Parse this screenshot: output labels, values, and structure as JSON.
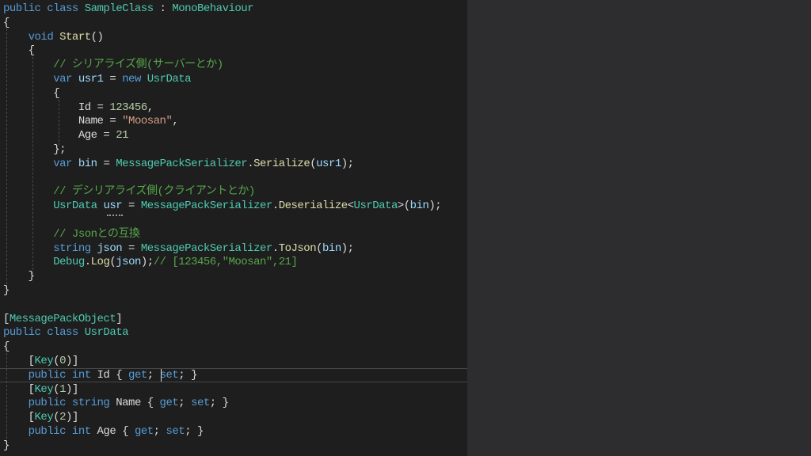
{
  "editor": {
    "background": "#1e1e1e",
    "side_panel_background": "#2d2d30",
    "colors": {
      "keyword": "#569cd6",
      "type": "#4ec9b0",
      "text": "#dcdcdc",
      "method": "#dcdcaa",
      "number": "#b5cea8",
      "string": "#d69d85",
      "comment": "#57a64a",
      "variable": "#9cdcfe"
    },
    "lines": [
      [
        [
          "kw",
          "public class "
        ],
        [
          "ty",
          "SampleClass"
        ],
        [
          "tx",
          " : "
        ],
        [
          "ty",
          "MonoBehaviour"
        ]
      ],
      [
        [
          "tx",
          "{"
        ]
      ],
      [
        [
          "tx",
          "    "
        ],
        [
          "kw",
          "void "
        ],
        [
          "fn",
          "Start"
        ],
        [
          "tx",
          "()"
        ]
      ],
      [
        [
          "tx",
          "    {"
        ]
      ],
      [
        [
          "tx",
          "        "
        ],
        [
          "cm",
          "// シリアライズ側(サーバーとか)"
        ]
      ],
      [
        [
          "tx",
          "        "
        ],
        [
          "kw",
          "var "
        ],
        [
          "va",
          "usr1"
        ],
        [
          "tx",
          " = "
        ],
        [
          "kw",
          "new "
        ],
        [
          "ty",
          "UsrData"
        ]
      ],
      [
        [
          "tx",
          "        {"
        ]
      ],
      [
        [
          "tx",
          "            Id = "
        ],
        [
          "nu",
          "123456"
        ],
        [
          "tx",
          ","
        ]
      ],
      [
        [
          "tx",
          "            Name = "
        ],
        [
          "st",
          "\"Moosan\""
        ],
        [
          "tx",
          ","
        ]
      ],
      [
        [
          "tx",
          "            Age = "
        ],
        [
          "nu",
          "21"
        ]
      ],
      [
        [
          "tx",
          "        };"
        ]
      ],
      [
        [
          "tx",
          "        "
        ],
        [
          "kw",
          "var "
        ],
        [
          "va",
          "bin"
        ],
        [
          "tx",
          " = "
        ],
        [
          "ty",
          "MessagePackSerializer"
        ],
        [
          "tx",
          "."
        ],
        [
          "fn",
          "Serialize"
        ],
        [
          "tx",
          "("
        ],
        [
          "va",
          "usr1"
        ],
        [
          "tx",
          ");"
        ]
      ],
      [],
      [
        [
          "tx",
          "        "
        ],
        [
          "cm",
          "// デシリアライズ側(クライアントとか)"
        ]
      ],
      [
        [
          "tx",
          "        "
        ],
        [
          "ty",
          "UsrData"
        ],
        [
          "tx",
          " "
        ],
        [
          "va",
          "usr"
        ],
        [
          "tx",
          " = "
        ],
        [
          "ty",
          "MessagePackSerializer"
        ],
        [
          "tx",
          "."
        ],
        [
          "fn",
          "Deserialize"
        ],
        [
          "tx",
          "<"
        ],
        [
          "ty",
          "UsrData"
        ],
        [
          "tx",
          ">("
        ],
        [
          "va",
          "bin"
        ],
        [
          "tx",
          ");"
        ]
      ],
      [],
      [
        [
          "tx",
          "        "
        ],
        [
          "cm",
          "// Jsonとの互換"
        ]
      ],
      [
        [
          "tx",
          "        "
        ],
        [
          "kw",
          "string "
        ],
        [
          "va",
          "json"
        ],
        [
          "tx",
          " = "
        ],
        [
          "ty",
          "MessagePackSerializer"
        ],
        [
          "tx",
          "."
        ],
        [
          "fn",
          "ToJson"
        ],
        [
          "tx",
          "("
        ],
        [
          "va",
          "bin"
        ],
        [
          "tx",
          ");"
        ]
      ],
      [
        [
          "tx",
          "        "
        ],
        [
          "ty",
          "Debug"
        ],
        [
          "tx",
          "."
        ],
        [
          "fn",
          "Log"
        ],
        [
          "tx",
          "("
        ],
        [
          "va",
          "json"
        ],
        [
          "tx",
          ");"
        ],
        [
          "cm",
          "// [123456,\"Moosan\",21]"
        ]
      ],
      [
        [
          "tx",
          "    }"
        ]
      ],
      [
        [
          "tx",
          "}"
        ]
      ],
      [],
      [
        [
          "tx",
          "["
        ],
        [
          "ty",
          "MessagePackObject"
        ],
        [
          "tx",
          "]"
        ]
      ],
      [
        [
          "kw",
          "public class "
        ],
        [
          "ty",
          "UsrData"
        ]
      ],
      [
        [
          "tx",
          "{"
        ]
      ],
      [
        [
          "tx",
          "    ["
        ],
        [
          "ty",
          "Key"
        ],
        [
          "tx",
          "("
        ],
        [
          "nu",
          "0"
        ],
        [
          "tx",
          ")]"
        ]
      ],
      [
        [
          "tx",
          "    "
        ],
        [
          "kw",
          "public int "
        ],
        [
          "tx",
          "Id { "
        ],
        [
          "kw",
          "get"
        ],
        [
          "tx",
          "; "
        ],
        [
          "kw",
          "set"
        ],
        [
          "tx",
          "; }"
        ]
      ],
      [
        [
          "tx",
          "    ["
        ],
        [
          "ty",
          "Key"
        ],
        [
          "tx",
          "("
        ],
        [
          "nu",
          "1"
        ],
        [
          "tx",
          ")]"
        ]
      ],
      [
        [
          "tx",
          "    "
        ],
        [
          "kw",
          "public string "
        ],
        [
          "tx",
          "Name { "
        ],
        [
          "kw",
          "get"
        ],
        [
          "tx",
          "; "
        ],
        [
          "kw",
          "set"
        ],
        [
          "tx",
          "; }"
        ]
      ],
      [
        [
          "tx",
          "    ["
        ],
        [
          "ty",
          "Key"
        ],
        [
          "tx",
          "("
        ],
        [
          "nu",
          "2"
        ],
        [
          "tx",
          ")]"
        ]
      ],
      [
        [
          "tx",
          "    "
        ],
        [
          "kw",
          "public int "
        ],
        [
          "tx",
          "Age { "
        ],
        [
          "kw",
          "get"
        ],
        [
          "tx",
          "; "
        ],
        [
          "kw",
          "set"
        ],
        [
          "tx",
          "; }"
        ]
      ],
      [
        [
          "tx",
          "}"
        ]
      ]
    ]
  }
}
